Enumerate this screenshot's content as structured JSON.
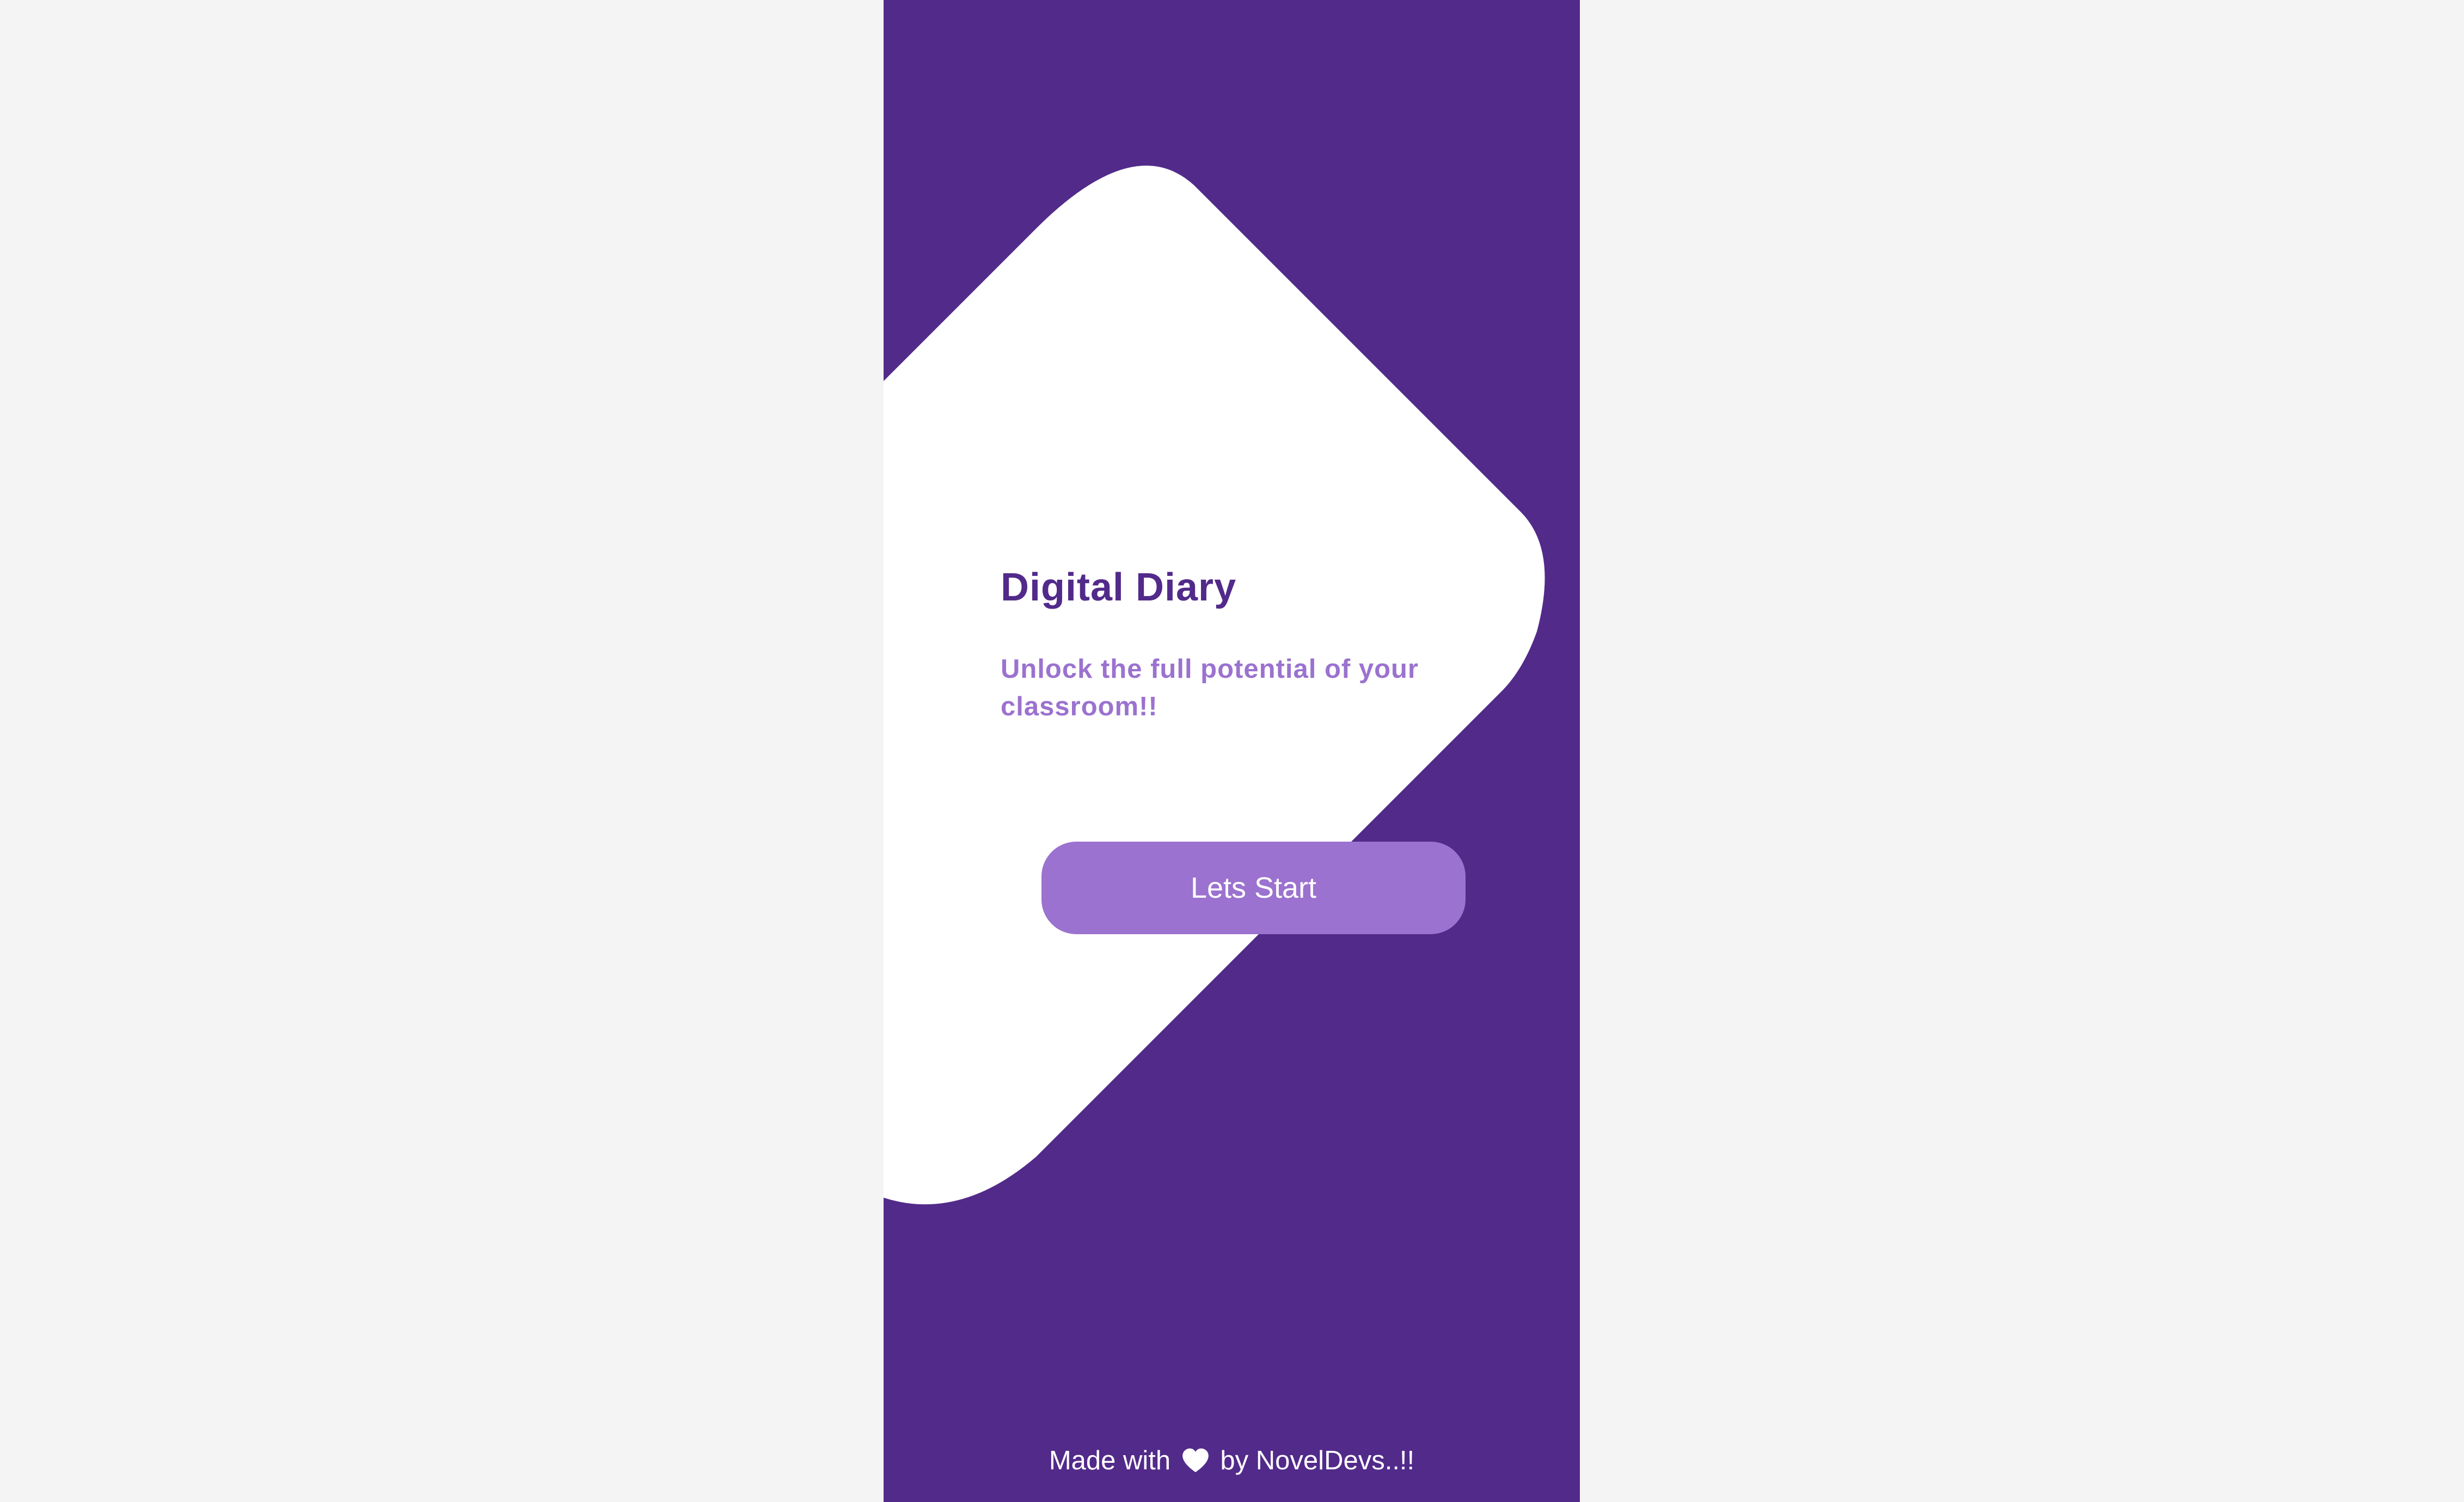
{
  "splash": {
    "title": "Digital Diary",
    "subtitle": "Unlock the full potential of your classroom!!",
    "start_button_label": "Lets Start",
    "footer": {
      "prefix": "Made with",
      "icon": "heart-icon",
      "suffix": "by NovelDevs..!!"
    }
  },
  "colors": {
    "primary": "#522a8a",
    "accent": "#9b72cf",
    "surface": "#ffffff",
    "page_background": "#f4f4f4"
  }
}
